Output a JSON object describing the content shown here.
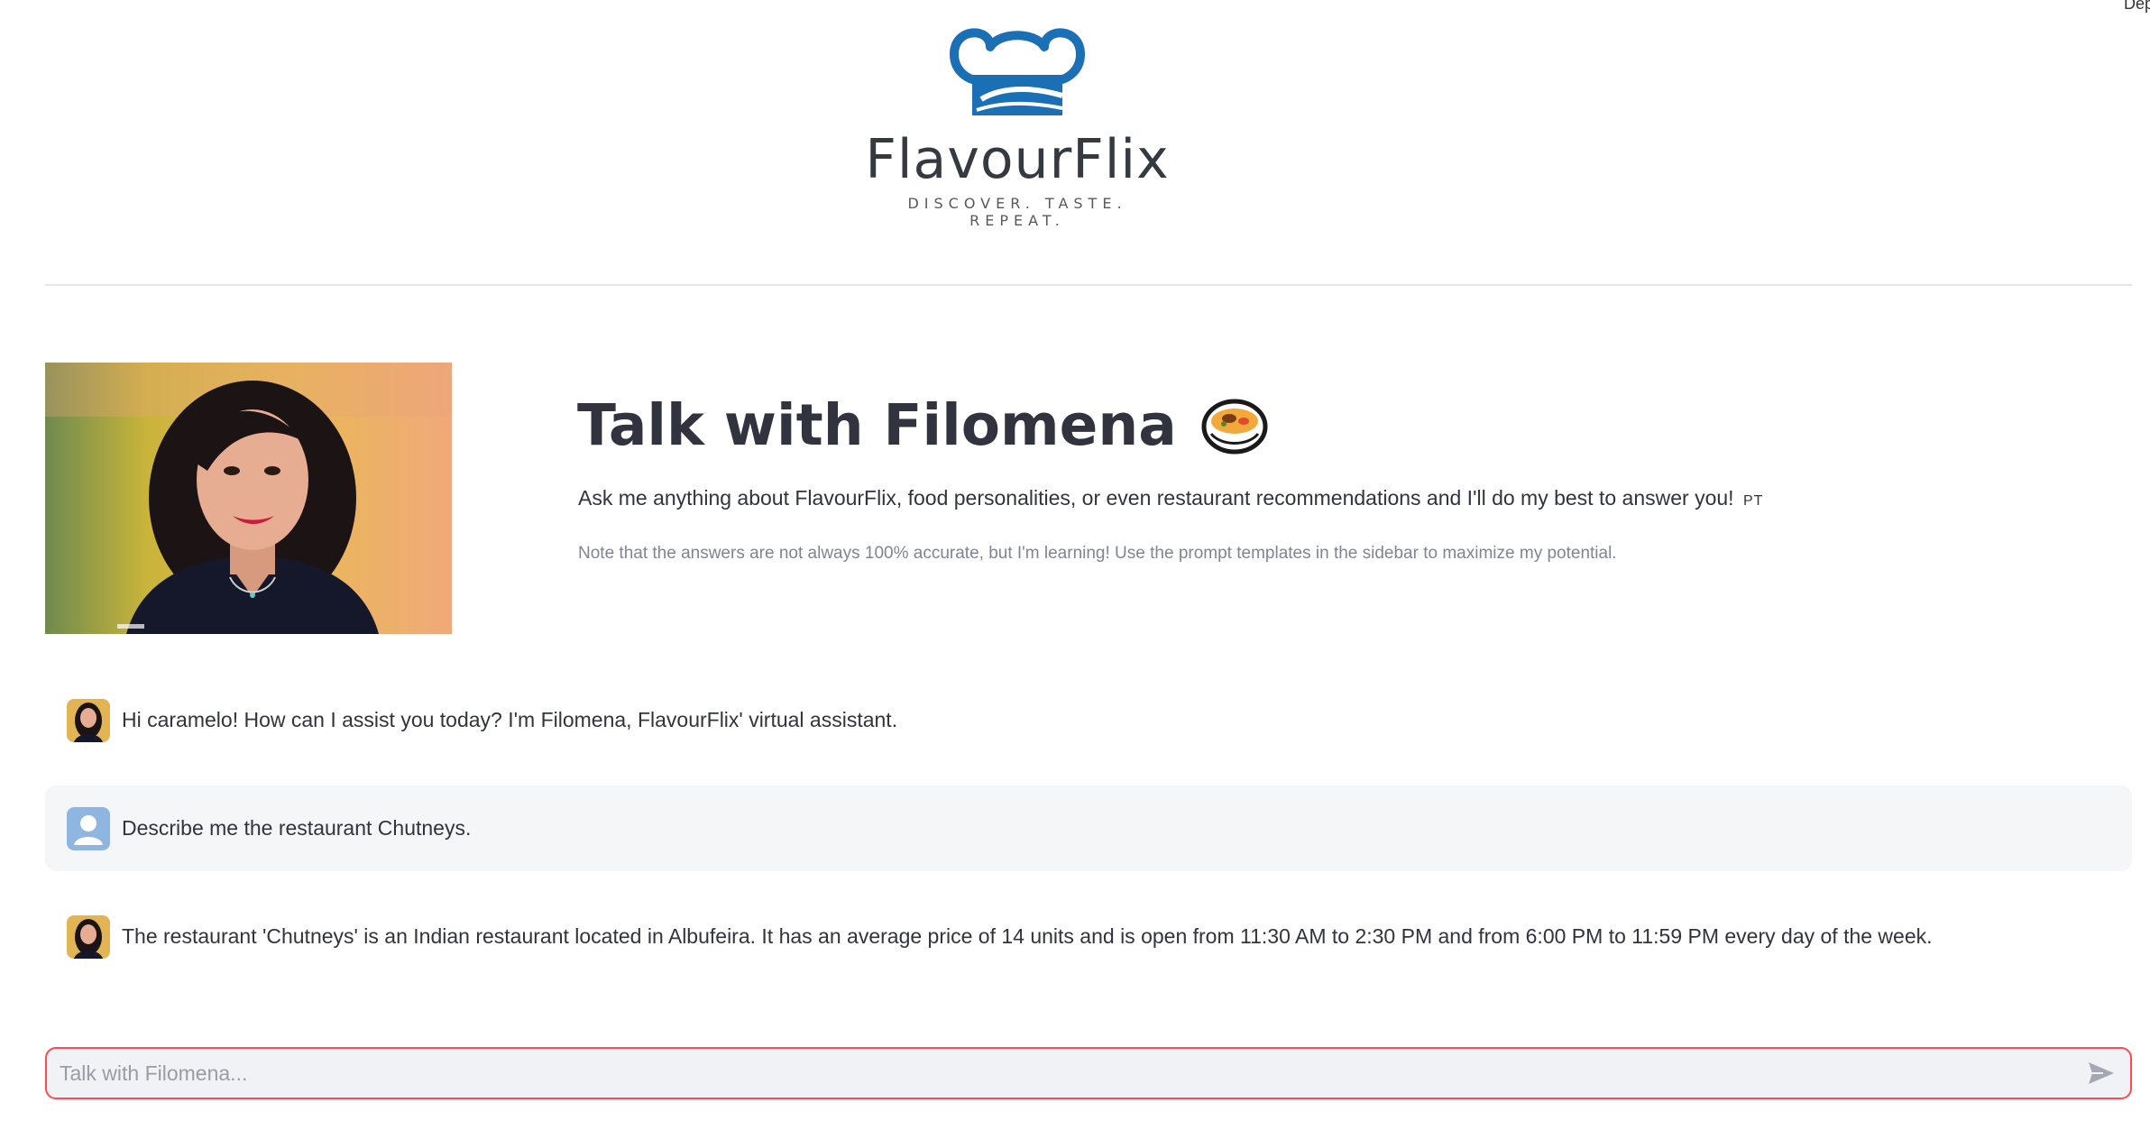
{
  "header": {
    "deploy_label": "Dep"
  },
  "logo": {
    "name": "FlavourFlix",
    "tagline": "DISCOVER. TASTE. REPEAT.",
    "brand_color": "#1b6fb5"
  },
  "intro": {
    "title": "Talk with Filomena",
    "title_icon": "bowl-of-food-icon",
    "subtitle": "Ask me anything about FlavourFlix, food personalities, or even restaurant recommendations and I'll do my best to answer you!",
    "language_toggle": "PT",
    "note": "Note that the answers are not always 100% accurate, but I'm learning! Use the prompt templates in the sidebar to maximize my potential."
  },
  "messages": [
    {
      "role": "assistant",
      "avatar": "filomena-avatar",
      "text": "Hi caramelo! How can I assist you today? I'm Filomena, FlavourFlix' virtual assistant."
    },
    {
      "role": "user",
      "avatar": "user-avatar-icon",
      "text": "Describe me the restaurant Chutneys."
    },
    {
      "role": "assistant",
      "avatar": "filomena-avatar",
      "text": "The restaurant 'Chutneys' is an Indian restaurant located in Albufeira. It has an average price of 14 units and is open from 11:30 AM to 2:30 PM and from 6:00 PM to 11:59 PM every day of the week."
    }
  ],
  "chat_input": {
    "placeholder": "Talk with Filomena...",
    "value": "",
    "send_icon": "send-arrow-icon"
  },
  "colors": {
    "text": "#31333f",
    "muted": "#808495",
    "input_border": "#ff4b4b",
    "user_bubble": "#f5f6f8",
    "input_bg": "#f0f2f6"
  }
}
